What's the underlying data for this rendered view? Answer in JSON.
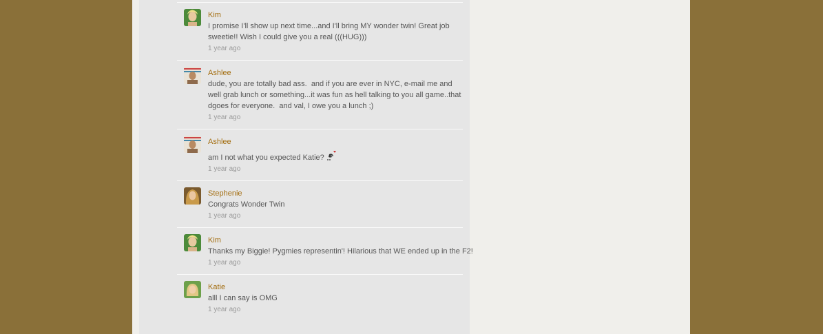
{
  "comments": [
    {
      "author": "Kim",
      "avatar": "avatar-kim",
      "text": "I promise I'll show up next time...and I'll bring MY wonder twin! Great job sweetie!! Wish I could give you a real (((HUG)))",
      "time": "1 year ago"
    },
    {
      "author": "Ashlee",
      "avatar": "avatar-ashlee",
      "text": "dude, you are totally bad ass.  and if you are ever in NYC, e-mail me and well grab lunch or something...it was fun as hell talking to you all game..that dgoes for everyone.  and val, I owe you a lunch ;)",
      "time": "1 year ago"
    },
    {
      "author": "Ashlee",
      "avatar": "avatar-ashlee",
      "text": "am I not what you expected Katie?",
      "has_emoticon": true,
      "emoticon": "kiss-emoticon-icon",
      "time": "1 year ago"
    },
    {
      "author": "Stephenie",
      "avatar": "avatar-stephenie",
      "text": "Congrats Wonder Twin",
      "time": "1 year ago"
    },
    {
      "author": "Kim",
      "avatar": "avatar-kim",
      "text": "Thanks my Biggie! Pygmies representin'! Hilarious that WE ended up in the F2!",
      "time": "1 year ago"
    },
    {
      "author": "Katie",
      "avatar": "avatar-katie",
      "text": "alll I can say is OMG",
      "time": "1 year ago"
    }
  ],
  "colors": {
    "background": "#8a7039",
    "page": "#f0efeb",
    "column": "#e6e6e6",
    "author_link": "#a36d0f",
    "text": "#555555",
    "timestamp": "#999999"
  }
}
